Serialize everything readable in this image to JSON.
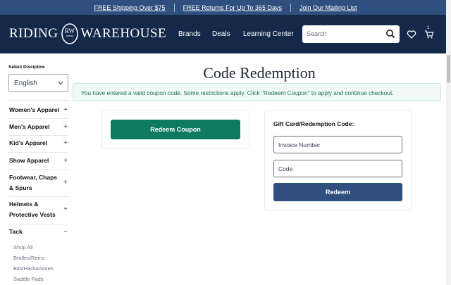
{
  "topbar": {
    "links": [
      "FREE Shipping Over $75",
      "FREE Returns For Up To 365 Days",
      "Join Our Mailing List"
    ]
  },
  "header": {
    "logo": {
      "word1": "Riding",
      "word2": "Warehouse",
      "monogram": "RW"
    },
    "nav": [
      "Brands",
      "Deals",
      "Learning Center"
    ],
    "search_placeholder": "Search",
    "cart_count": "1"
  },
  "sidebar": {
    "discipline_label": "Select Discipline",
    "discipline_value": "English",
    "categories": [
      {
        "label": "Women's Apparel",
        "toggle": "+"
      },
      {
        "label": "Men's Apparel",
        "toggle": "+"
      },
      {
        "label": "Kid's Apparel",
        "toggle": "+"
      },
      {
        "label": "Show Apparel",
        "toggle": "+"
      },
      {
        "label": "Footwear, Chaps & Spurs",
        "toggle": "+"
      },
      {
        "label": "Helmets & Protective Vests",
        "toggle": "+"
      },
      {
        "label": "Tack",
        "toggle": "−"
      }
    ],
    "tack_items": [
      "Shop All",
      "Bridles/Reins",
      "Bits/Hackamores",
      "Saddle Pads"
    ]
  },
  "main": {
    "title": "Code Redemption",
    "alert": "You have entered a valid coupon code. Some restrictions apply. Click \"Redeem Coupon\" to apply and continue checkout.",
    "redeem_coupon_label": "Redeem Coupon",
    "gift_card_label": "Gift Card/Redemption Code:",
    "invoice_placeholder": "Invoice Number",
    "code_placeholder": "Code",
    "redeem_label": "Redeem"
  },
  "colors": {
    "topbar": "#2f4f7f",
    "header": "#14294a",
    "green_button": "#0e7a5f",
    "blue_button": "#2f4f7f",
    "alert_bg": "#f0f9f6"
  }
}
